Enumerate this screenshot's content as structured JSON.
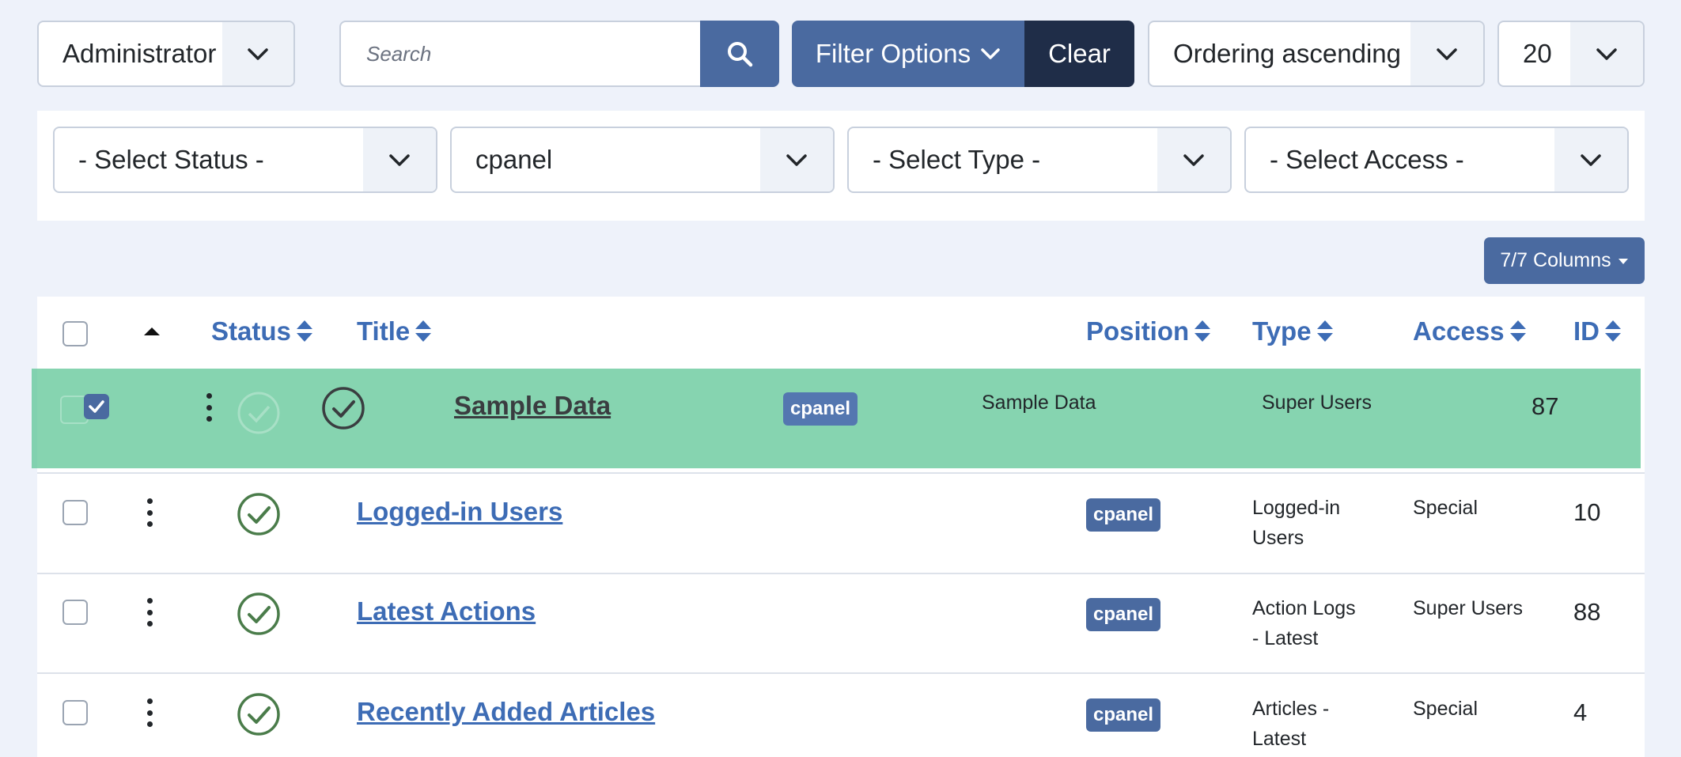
{
  "toolbar": {
    "client_select": "Administrator",
    "search_placeholder": "Search",
    "filter_options_label": "Filter Options",
    "clear_label": "Clear",
    "ordering_select": "Ordering ascending",
    "limit_select": "20"
  },
  "filters": {
    "status": "- Select Status -",
    "position": "cpanel",
    "type": "- Select Type -",
    "access": "- Select Access -"
  },
  "columns_button": "7/7 Columns",
  "table": {
    "headers": {
      "status": "Status",
      "title": "Title",
      "position": "Position",
      "type": "Type",
      "access": "Access",
      "id": "ID"
    },
    "dragged_row": {
      "title": "Sample Data",
      "position": "cpanel",
      "type": "Sample Data",
      "access": "Super Users",
      "id": "87"
    },
    "rows": [
      {
        "title": "Logged-in Users",
        "position": "cpanel",
        "type_line1": "Logged-in",
        "type_line2": "Users",
        "access": "Special",
        "id": "10"
      },
      {
        "title": "Latest Actions",
        "position": "cpanel",
        "type_line1": "Action Logs",
        "type_line2": "- Latest",
        "access": "Super Users",
        "id": "88"
      },
      {
        "title": "Recently Added Articles",
        "position": "cpanel",
        "type_line1": "Articles -",
        "type_line2": "Latest",
        "access": "Special",
        "id": "4"
      }
    ]
  },
  "colors": {
    "primary": "#4a6aa0",
    "dark": "#1f2d48",
    "link": "#3d6cb5",
    "status_ok": "#4a7c4a",
    "drag_highlight": "#58c492"
  }
}
